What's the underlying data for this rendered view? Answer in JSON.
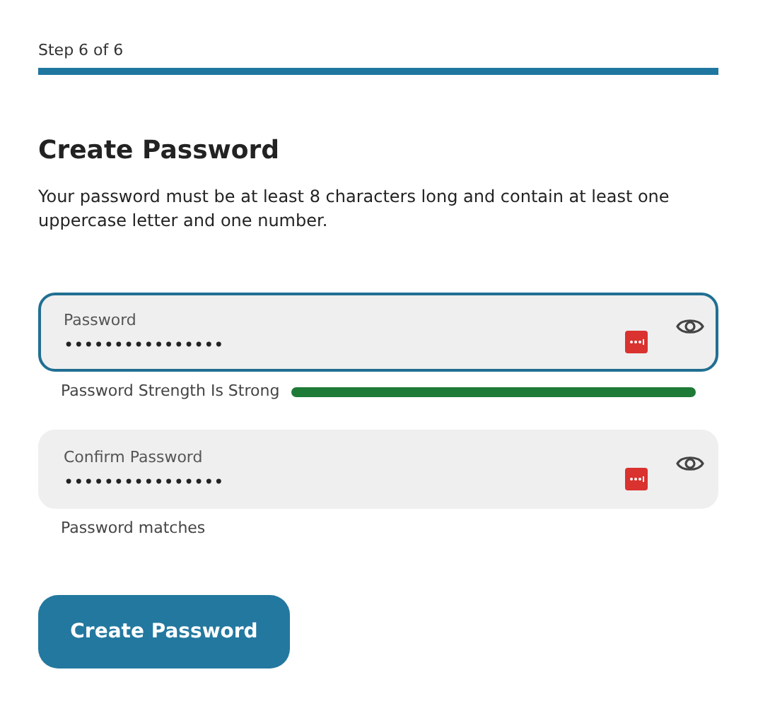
{
  "progress": {
    "label": "Step 6 of 6",
    "level": 1
  },
  "heading": "Create Password",
  "description": "Your password must be at least 8 characters long and contain at least one uppercase letter and one number.",
  "fields": [
    {
      "kind": "strength",
      "label": "Password",
      "value": "••••••••••••••••",
      "focused": true,
      "note": "Password Strength Is Strong"
    },
    {
      "kind": "match",
      "label": "Confirm Password",
      "value": "••••••••••••••••",
      "focused": false,
      "note": "Password matches"
    }
  ],
  "submit": "Create Password"
}
